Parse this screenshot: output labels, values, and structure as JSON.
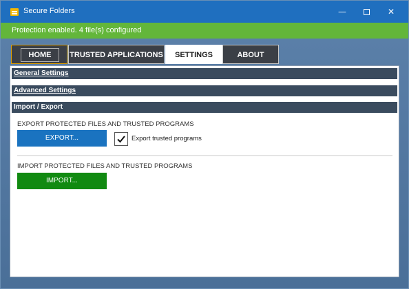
{
  "window": {
    "title": "Secure Folders",
    "controls": {
      "minimize": "—",
      "close": "✕"
    }
  },
  "status": {
    "text": "Protection enabled. 4 file(s) configured"
  },
  "tabs": [
    {
      "label": "HOME"
    },
    {
      "label": "TRUSTED APPLICATIONS"
    },
    {
      "label": "SETTINGS",
      "active": true
    },
    {
      "label": "ABOUT"
    }
  ],
  "settings": {
    "sections": [
      {
        "label": "General Settings"
      },
      {
        "label": "Advanced Settings"
      },
      {
        "label": "Import / Export"
      }
    ],
    "export": {
      "heading": "EXPORT PROTECTED FILES AND TRUSTED PROGRAMS",
      "button_label": "EXPORT...",
      "checkbox_label": "Export trusted programs",
      "checkbox_checked": true
    },
    "import": {
      "heading": "IMPORT PROTECTED FILES AND TRUSTED PROGRAMS",
      "button_label": "IMPORT..."
    }
  },
  "colors": {
    "titlebar": "#1f6fbf",
    "status_bar": "#63b63a",
    "export_button": "#1a73c0",
    "import_button": "#118a11",
    "section_header": "#3a4b5e"
  },
  "icons": {
    "app": "folder-shield-icon",
    "minimize": "minimize-icon",
    "maximize": "maximize-icon",
    "close": "close-icon",
    "check": "checkmark-icon"
  }
}
